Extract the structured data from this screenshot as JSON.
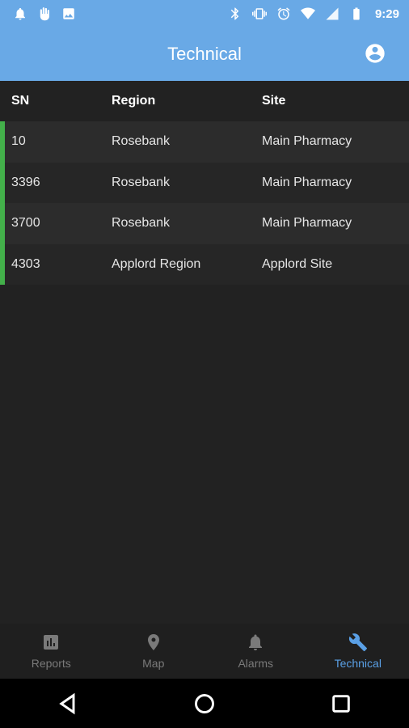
{
  "status_bar": {
    "time": "9:29",
    "left_icons": [
      "notification-bell-icon",
      "hand-icon",
      "image-icon"
    ],
    "right_icons": [
      "bluetooth-icon",
      "vibrate-icon",
      "alarm-icon",
      "wifi-icon",
      "signal-icon",
      "battery-icon"
    ]
  },
  "app_bar": {
    "title": "Technical",
    "account_icon": "account-circle-icon"
  },
  "table": {
    "headers": {
      "sn": "SN",
      "region": "Region",
      "site": "Site"
    },
    "rows": [
      {
        "sn": "10",
        "region": "Rosebank",
        "site": "Main Pharmacy"
      },
      {
        "sn": "3396",
        "region": "Rosebank",
        "site": "Main Pharmacy"
      },
      {
        "sn": "3700",
        "region": "Rosebank",
        "site": "Main Pharmacy"
      },
      {
        "sn": "4303",
        "region": "Applord Region",
        "site": "Applord Site"
      }
    ],
    "row_accent_color": "#43b04a"
  },
  "bottom_nav": {
    "items": [
      {
        "label": "Reports",
        "icon": "bar-chart-icon",
        "active": false
      },
      {
        "label": "Map",
        "icon": "map-pin-icon",
        "active": false
      },
      {
        "label": "Alarms",
        "icon": "bell-icon",
        "active": false
      },
      {
        "label": "Technical",
        "icon": "wrench-icon",
        "active": true
      }
    ],
    "active_color": "#5aa0e6"
  },
  "system_nav": {
    "buttons": [
      "back-icon",
      "home-icon",
      "recents-icon"
    ]
  },
  "colors": {
    "primary": "#69a9e6",
    "background": "#222222"
  }
}
